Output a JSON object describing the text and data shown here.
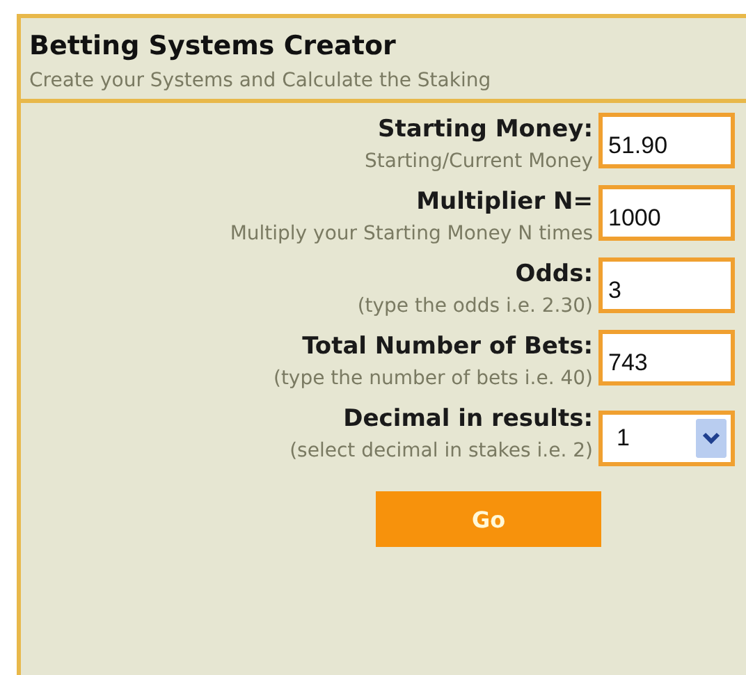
{
  "panel": {
    "title": "Betting Systems Creator",
    "subtitle": "Create your Systems and Calculate the Staking"
  },
  "fields": [
    {
      "kind": "text",
      "label": "Starting Money:",
      "hint": "Starting/Current Money",
      "value": "51.90"
    },
    {
      "kind": "text",
      "label": "Multiplier N=",
      "hint": "Multiply your Starting Money N times",
      "value": "1000"
    },
    {
      "kind": "text",
      "label": "Odds:",
      "hint": "(type the odds i.e. 2.30)",
      "value": "3"
    },
    {
      "kind": "text",
      "label": "Total Number of Bets:",
      "hint": "(type the number of bets i.e. 40)",
      "value": "743"
    },
    {
      "kind": "select",
      "label": "Decimal in results:",
      "hint": "(select decimal in stakes i.e. 2)",
      "value": "1"
    }
  ],
  "button": "Go"
}
